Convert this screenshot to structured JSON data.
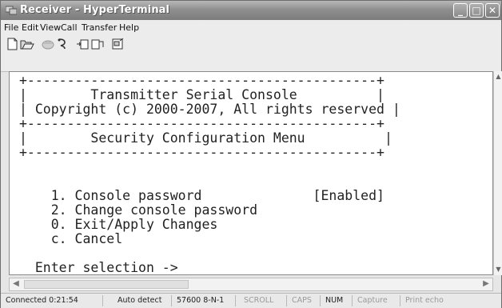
{
  "window": {
    "title": "Receiver - HyperTerminal",
    "controls": [
      "minimize",
      "maximize",
      "close"
    ]
  },
  "menubar": {
    "file": "File",
    "edit": "Edit",
    "view": "View",
    "call": "Call",
    "transfer": "Transfer",
    "help": "Help"
  },
  "toolbar": {
    "buttons": [
      "new-icon",
      "open-icon",
      "disconnect-icon",
      "dial-icon",
      "send-icon",
      "receive-icon",
      "properties-icon"
    ]
  },
  "terminal": {
    "lines": [
      "+--------------------------------------------+",
      "|        Transmitter Serial Console          |",
      "| Copyright (c) 2000-2007, All rights reserved |",
      "+--------------------------------------------+",
      "|        Security Configuration Menu          |",
      "+--------------------------------------------+",
      "",
      "",
      "    1. Console password              [Enabled]",
      "    2. Change console password",
      "    0. Exit/Apply Changes",
      "    c. Cancel",
      "",
      "  Enter selection -> _"
    ]
  },
  "statusbar": {
    "connected": "Connected 0:21:54",
    "detect": "Auto detect",
    "settings": "57600 8-N-1",
    "scroll": "SCROLL",
    "caps": "CAPS",
    "num": "NUM",
    "capture": "Capture",
    "print_echo": "Print echo"
  }
}
